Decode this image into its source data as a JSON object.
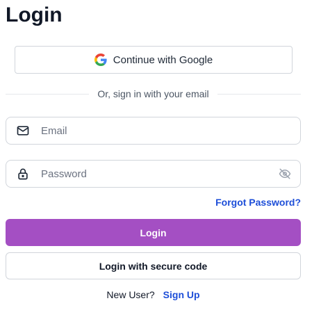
{
  "page": {
    "title": "Login"
  },
  "google": {
    "label": "Continue with Google",
    "icon": "google-logo-icon"
  },
  "divider": {
    "text": "Or, sign in with your email"
  },
  "email": {
    "placeholder": "Email",
    "value": "",
    "icon": "mail-icon"
  },
  "password": {
    "placeholder": "Password",
    "value": "",
    "icon": "lock-icon",
    "toggle_icon": "eye-off-icon"
  },
  "forgot": {
    "label": "Forgot Password?"
  },
  "login": {
    "label": "Login",
    "color": "#a44fc3"
  },
  "secure_code": {
    "label": "Login with secure code"
  },
  "signup": {
    "prompt": "New User?",
    "link": "Sign Up"
  },
  "colors": {
    "link": "#1d4ed8",
    "border": "#d1d5db"
  }
}
